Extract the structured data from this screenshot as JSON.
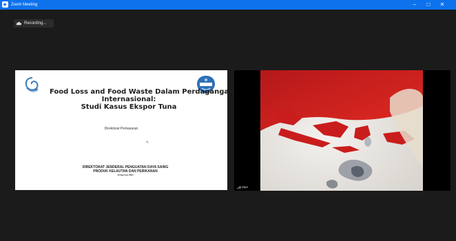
{
  "window": {
    "title": "Zoom Meeting",
    "controls": {
      "minimize": "–",
      "maximize": "□",
      "close": "✕"
    }
  },
  "recording": {
    "label": "Recording...",
    "icon": "recording-cloud-icon"
  },
  "shared_screen": {
    "title_lines": [
      "Food Loss and Food Waste Dalam Perdagangan",
      "Internasional:",
      "Studi Kasus  Ekspor Tuna"
    ],
    "department": "Direktorat Pemasaran",
    "footer_lines": [
      "DIREKTORAT JENDERAL PENGUATAN DAYA SAING",
      "PRODUK KELAUTAN DAN PERIKANAN"
    ],
    "date": "13 Agustus 2021",
    "cursor": "↖",
    "logo_left": "kkp-ministry-logo",
    "logo_right": "bbm-badge-logo"
  },
  "video": {
    "participant_name": "Jaya",
    "signal_icon": "signal-bars-icon",
    "scene": "indonesia-map-flag-background"
  },
  "colors": {
    "titlebar": "#0e72ed",
    "stage": "#1b1b1b",
    "flag_red": "#d82320",
    "flag_white": "#f1efec"
  }
}
